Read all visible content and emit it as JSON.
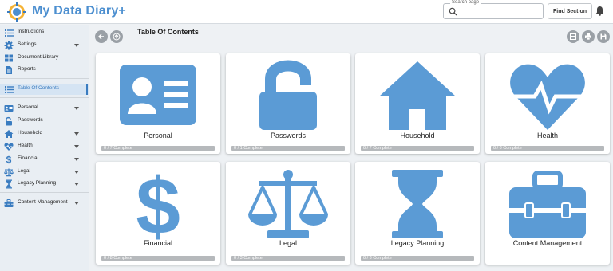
{
  "app": {
    "title": "My Data Diary+"
  },
  "search": {
    "label": "Search page",
    "placeholder": "",
    "value": "",
    "button_label": "Find Section"
  },
  "sidebar": {
    "items": [
      {
        "label": "Instructions",
        "icon": "list-icon",
        "chevron": false
      },
      {
        "label": "Settings",
        "icon": "gear-icon",
        "chevron": true
      },
      {
        "label": "Document Library",
        "icon": "grid-icon",
        "chevron": false
      },
      {
        "label": "Reports",
        "icon": "document-icon",
        "chevron": false
      },
      {
        "label": "Table Of Contents",
        "icon": "list-icon",
        "chevron": false,
        "active": true
      },
      {
        "label": "Personal",
        "icon": "id-card-icon",
        "chevron": true
      },
      {
        "label": "Passwords",
        "icon": "unlock-icon",
        "chevron": false
      },
      {
        "label": "Household",
        "icon": "house-icon",
        "chevron": true
      },
      {
        "label": "Health",
        "icon": "heart-pulse-icon",
        "chevron": true
      },
      {
        "label": "Financial",
        "icon": "dollar-icon",
        "chevron": true
      },
      {
        "label": "Legal",
        "icon": "scales-icon",
        "chevron": true
      },
      {
        "label": "Legacy Planning",
        "icon": "hourglass-icon",
        "chevron": true
      },
      {
        "label": "Content Management",
        "icon": "toolbox-icon",
        "chevron": true
      }
    ]
  },
  "main": {
    "title": "Table Of Contents",
    "cards": [
      {
        "title": "Personal",
        "icon": "id-card-icon",
        "progress_text": "0 / 7 Complete"
      },
      {
        "title": "Passwords",
        "icon": "unlock-icon",
        "progress_text": "0 / 1 Complete"
      },
      {
        "title": "Household",
        "icon": "house-icon",
        "progress_text": "0 / 7 Complete"
      },
      {
        "title": "Health",
        "icon": "heart-pulse-icon",
        "progress_text": "0 / 8 Complete"
      },
      {
        "title": "Financial",
        "icon": "dollar-icon",
        "progress_text": "0 / 8 Complete"
      },
      {
        "title": "Legal",
        "icon": "scales-icon",
        "progress_text": "0 / 3 Complete"
      },
      {
        "title": "Legacy Planning",
        "icon": "hourglass-icon",
        "progress_text": "0 / 3 Complete"
      },
      {
        "title": "Content Management",
        "icon": "toolbox-icon",
        "progress_text": ""
      }
    ]
  },
  "colors": {
    "accent": "#5b9bd5",
    "title_blue": "#4c8fd0",
    "progress_grey": "#b6b9bc"
  }
}
